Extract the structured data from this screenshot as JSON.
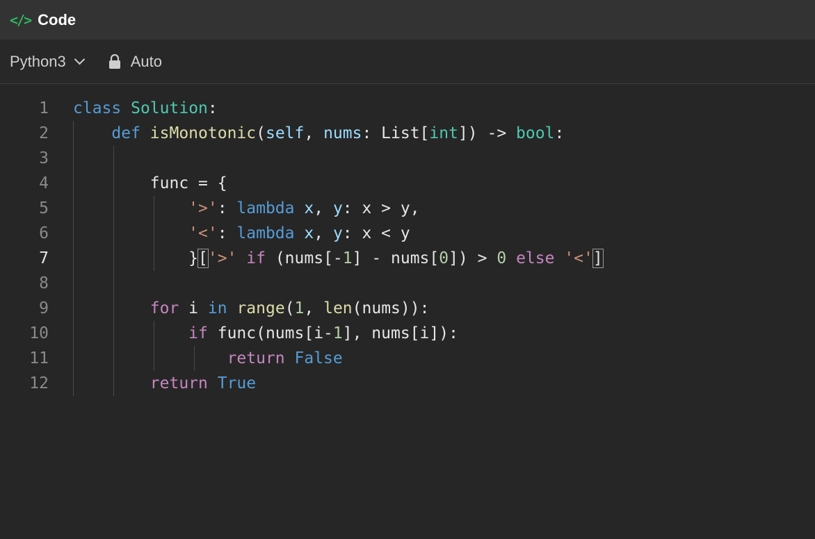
{
  "header": {
    "icon": "code-icon",
    "icon_glyph": "</>",
    "title": "Code"
  },
  "toolbar": {
    "language": "Python3",
    "auto_icon": "lock-icon",
    "auto_label": "Auto"
  },
  "colors": {
    "accent_green": "#2db55d",
    "keyword_blue": "#569cd6",
    "class_teal": "#4ec9b0",
    "function_yellow": "#dcdcaa",
    "param_lightblue": "#9cdcfe",
    "string_orange": "#ce9178",
    "number_green": "#b5cea8",
    "control_purple": "#c586c0"
  },
  "editor": {
    "active_line": 7,
    "lines": [
      {
        "n": "1",
        "text": "class Solution:"
      },
      {
        "n": "2",
        "text": "    def isMonotonic(self, nums: List[int]) -> bool:"
      },
      {
        "n": "3",
        "text": ""
      },
      {
        "n": "4",
        "text": "        func = {"
      },
      {
        "n": "5",
        "text": "            '>': lambda x, y: x > y,"
      },
      {
        "n": "6",
        "text": "            '<': lambda x, y: x < y"
      },
      {
        "n": "7",
        "text": "            }['>' if (nums[-1] - nums[0]) > 0 else '<']"
      },
      {
        "n": "8",
        "text": ""
      },
      {
        "n": "9",
        "text": "        for i in range(1, len(nums)):"
      },
      {
        "n": "10",
        "text": "            if func(nums[i-1], nums[i]):"
      },
      {
        "n": "11",
        "text": "                return False"
      },
      {
        "n": "12",
        "text": "        return True"
      }
    ]
  }
}
